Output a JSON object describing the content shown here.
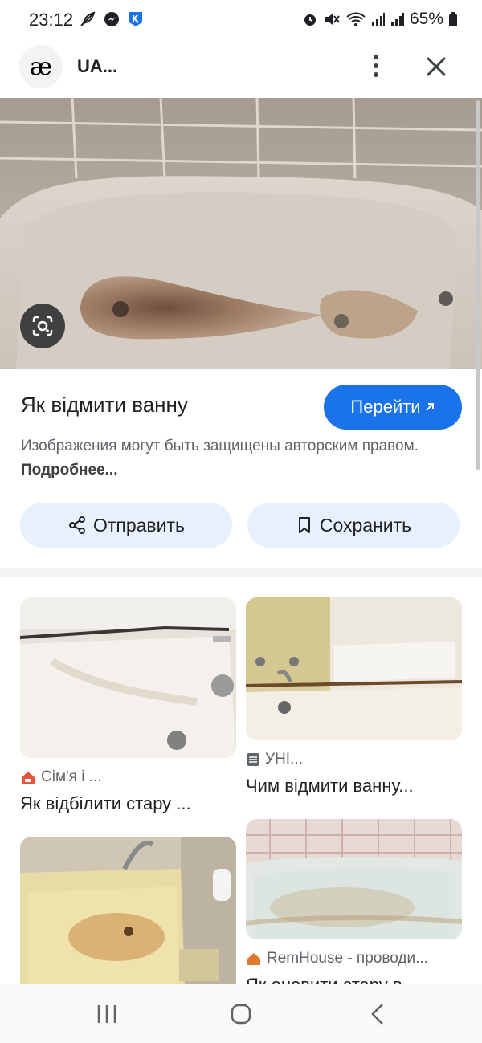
{
  "status_bar": {
    "time": "23:12",
    "battery": "65%"
  },
  "header": {
    "logo_text": "æ",
    "site_name": "UA..."
  },
  "result": {
    "title": "Як відмити ванну",
    "visit_label": "Перейти",
    "copyright_text": "Изображения могут быть защищены авторским правом.",
    "more_link": "Подробнее..."
  },
  "actions": {
    "share_label": "Отправить",
    "save_label": "Сохранить"
  },
  "related": [
    {
      "source": "Сім'я і ...",
      "title": "Як відбілити стару ..."
    },
    {
      "source": "УНІ...",
      "title": "Чим відмити ванну..."
    },
    {
      "source": "",
      "title": ""
    },
    {
      "source": "RemHouse - проводи...",
      "title": "Як оновити стару в..."
    }
  ],
  "colors": {
    "accent": "#1a73e8",
    "chip_bg": "#e8f0fe"
  }
}
